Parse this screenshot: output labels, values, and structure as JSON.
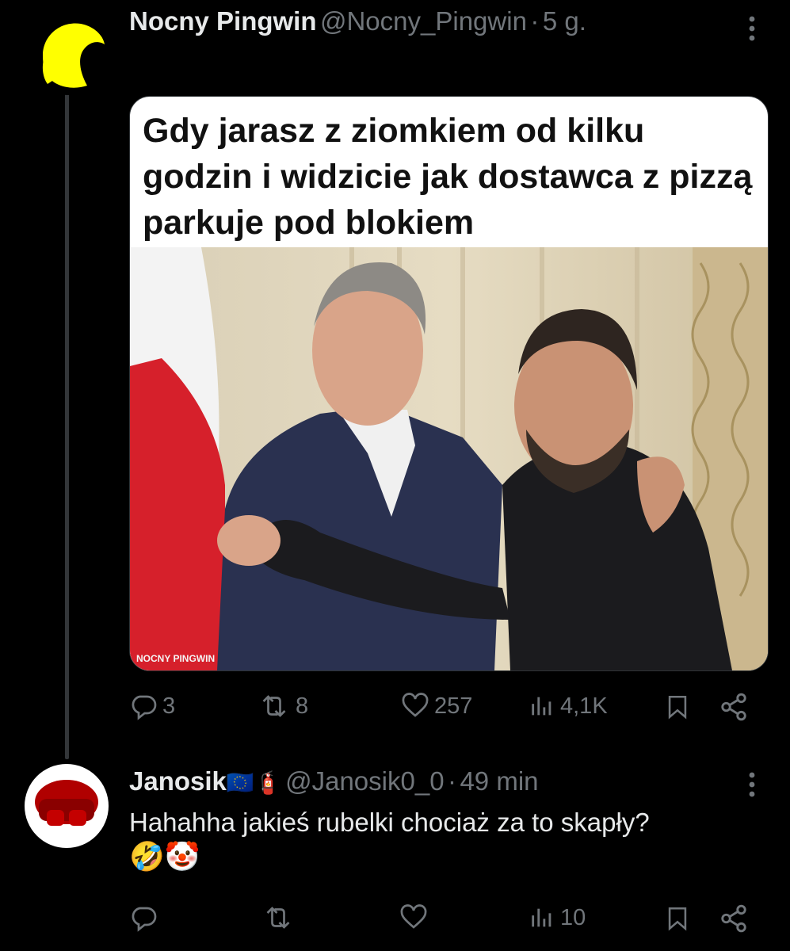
{
  "colors": {
    "background": "#000000",
    "text": "#e7e9ea",
    "muted": "#71767b",
    "line": "#333639",
    "avatar1_bg": "#000000",
    "avatar1_fg": "#ffff00",
    "avatar2_bg": "#ffffff",
    "avatar2_fg": "#b00000"
  },
  "tweet": {
    "author_name": "Nocny Pingwin",
    "author_handle": "@Nocny_Pingwin",
    "separator": "·",
    "time": "5 g.",
    "media_caption": "Gdy jarasz z ziomkiem od kilku godzin i widzicie jak dostawca z pizzą parkuje pod blokiem",
    "watermark": "NOCNY PINGWIN",
    "stats": {
      "replies": "3",
      "reposts": "8",
      "likes": "257",
      "views": "4,1K"
    }
  },
  "reply": {
    "author_name": "Janosik",
    "name_emojis": "🇪🇺🧯",
    "author_handle": "@Janosik0_0",
    "separator": "·",
    "time": "49 min",
    "text": "Hahahha jakieś rubelki chociaż za to skapły?",
    "text_emojis": "🤣🤡",
    "stats": {
      "replies": "",
      "reposts": "",
      "likes": "",
      "views": "10"
    }
  },
  "icons": [
    "more-icon",
    "reply-icon",
    "repost-icon",
    "like-icon",
    "views-icon",
    "bookmark-icon",
    "share-icon"
  ]
}
